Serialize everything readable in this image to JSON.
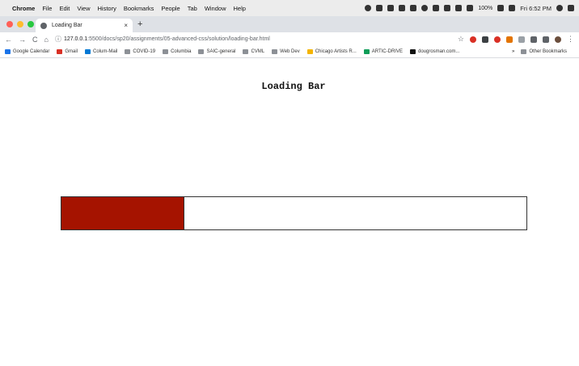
{
  "menubar": {
    "apple": "",
    "app": "Chrome",
    "items": [
      "File",
      "Edit",
      "View",
      "History",
      "Bookmarks",
      "People",
      "Tab",
      "Window",
      "Help"
    ],
    "battery": "100%",
    "clock": "Fri 6:52 PM"
  },
  "tab": {
    "title": "Loading Bar",
    "close": "×",
    "new_tab": "+"
  },
  "toolbar": {
    "back": "←",
    "forward": "→",
    "reload": "C",
    "home": "⌂",
    "url_host": "127.0.0.1",
    "url_path": ":5500/docs/sp20/assignments/05-advanced-css/solution/loading-bar.html"
  },
  "bookmarks": {
    "items": [
      {
        "label": "Google Calendar",
        "icon": "calendar-icon",
        "color": "#1a73e8"
      },
      {
        "label": "Gmail",
        "icon": "gmail-icon",
        "color": "#d93025"
      },
      {
        "label": "Colum-Mail",
        "icon": "mail-icon",
        "color": "#0078d4"
      },
      {
        "label": "COVID-19",
        "icon": "folder-icon",
        "color": "#8c9096"
      },
      {
        "label": "Columbia",
        "icon": "folder-icon",
        "color": "#8c9096"
      },
      {
        "label": "SAIC-general",
        "icon": "folder-icon",
        "color": "#8c9096"
      },
      {
        "label": "CVML",
        "icon": "folder-icon",
        "color": "#8c9096"
      },
      {
        "label": "Web Dev",
        "icon": "folder-icon",
        "color": "#8c9096"
      },
      {
        "label": "Chicago Artists R...",
        "icon": "doc-icon",
        "color": "#f4b400"
      },
      {
        "label": "ARTIC-DRIVE",
        "icon": "drive-icon",
        "color": "#0f9d58"
      },
      {
        "label": "dougrosman.com...",
        "icon": "site-icon",
        "color": "#111111"
      }
    ],
    "more": "»",
    "other": "Other Bookmarks"
  },
  "page": {
    "heading": "Loading Bar",
    "progress": 0.265,
    "fill_color": "#a51300"
  }
}
